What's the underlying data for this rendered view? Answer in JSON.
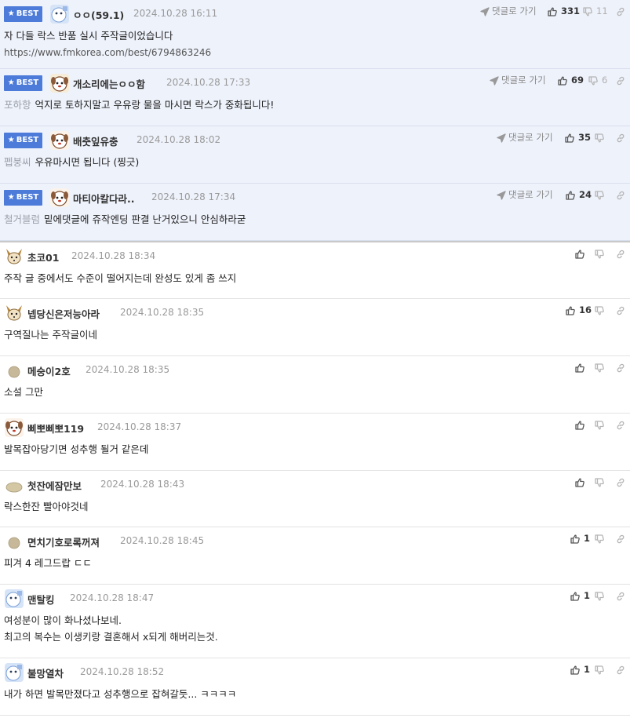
{
  "best_label": "BEST",
  "goto_label": "댓글로 가기",
  "comments": [
    {
      "best": true,
      "nick": "ㅇㅇ(59.1)",
      "date": "2024.10.28 16:11",
      "prefix": "",
      "text": "자 다들 락스 반품 실시 주작글이었습니다",
      "link": "https://www.fmkorea.com/best/6794863246",
      "up": "331",
      "down": "11",
      "avatar": "ice"
    },
    {
      "best": true,
      "nick": "개소리에는ㅇㅇ함",
      "date": "2024.10.28 17:33",
      "prefix": "포하항",
      "text": "억지로 토하지말고 우유랑 물을 마시면 락스가 중화됩니다!",
      "up": "69",
      "down": "6",
      "avatar": "dog"
    },
    {
      "best": true,
      "nick": "배춧잎유충",
      "date": "2024.10.28 18:02",
      "prefix": "펩붕씨",
      "text": "우유마시면 됩니다 (찡긋)",
      "up": "35",
      "down": "",
      "avatar": "puppy"
    },
    {
      "best": true,
      "nick": "마티아칼다라..",
      "date": "2024.10.28 17:34",
      "prefix": "철거블럼",
      "text": "밑에댓글에 쥬작엔딩 판결 난거있으니 안심하라굳",
      "up": "24",
      "down": "",
      "avatar": "puppy"
    },
    {
      "best": false,
      "nick": "초코01",
      "date": "2024.10.28 18:34",
      "prefix": "",
      "text": "주작 글 중에서도 수준이 떨어지는데 완성도 있게 좀 쓰지",
      "up": "",
      "down": "",
      "avatar": "fox"
    },
    {
      "best": false,
      "nick": "넵당신은저능아라",
      "date": "2024.10.28 18:35",
      "prefix": "",
      "text": "구역질나는 주작글이네",
      "up": "16",
      "down": "",
      "avatar": "fox"
    },
    {
      "best": false,
      "nick": "메숭이2호",
      "date": "2024.10.28 18:35",
      "prefix": "",
      "text": "소설 그만",
      "up": "",
      "down": "",
      "avatar": "egg"
    },
    {
      "best": false,
      "nick": "삐뽀삐뽀119",
      "date": "2024.10.28 18:37",
      "prefix": "",
      "text": "발목잡아당기면 성추행 될거 같은데",
      "up": "",
      "down": "",
      "avatar": "puppy"
    },
    {
      "best": false,
      "nick": "첫잔에잠만보",
      "date": "2024.10.28 18:43",
      "prefix": "",
      "text": "락스한잔 빨아야것네",
      "up": "",
      "down": "",
      "avatar": "mound"
    },
    {
      "best": false,
      "nick": "면치기호로록꺼져",
      "date": "2024.10.28 18:45",
      "prefix": "",
      "text": "피겨 4 레그드랍 ㄷㄷ",
      "up": "1",
      "down": "",
      "avatar": "egg"
    },
    {
      "best": false,
      "nick": "맨탈킹",
      "date": "2024.10.28 18:47",
      "prefix": "",
      "text": "여성분이 많이 화나셨나보네.",
      "text2": "최고의 복수는 이생키랑 결혼해서 x되게 해버리는것.",
      "up": "1",
      "down": "",
      "avatar": "ice"
    },
    {
      "best": false,
      "nick": "불망열차",
      "date": "2024.10.28 18:52",
      "prefix": "",
      "text": "내가 하면 발목만졌다고 성추행으로 잡혀갈듯... ㅋㅋㅋㅋ",
      "up": "1",
      "down": "",
      "avatar": "ice"
    }
  ]
}
